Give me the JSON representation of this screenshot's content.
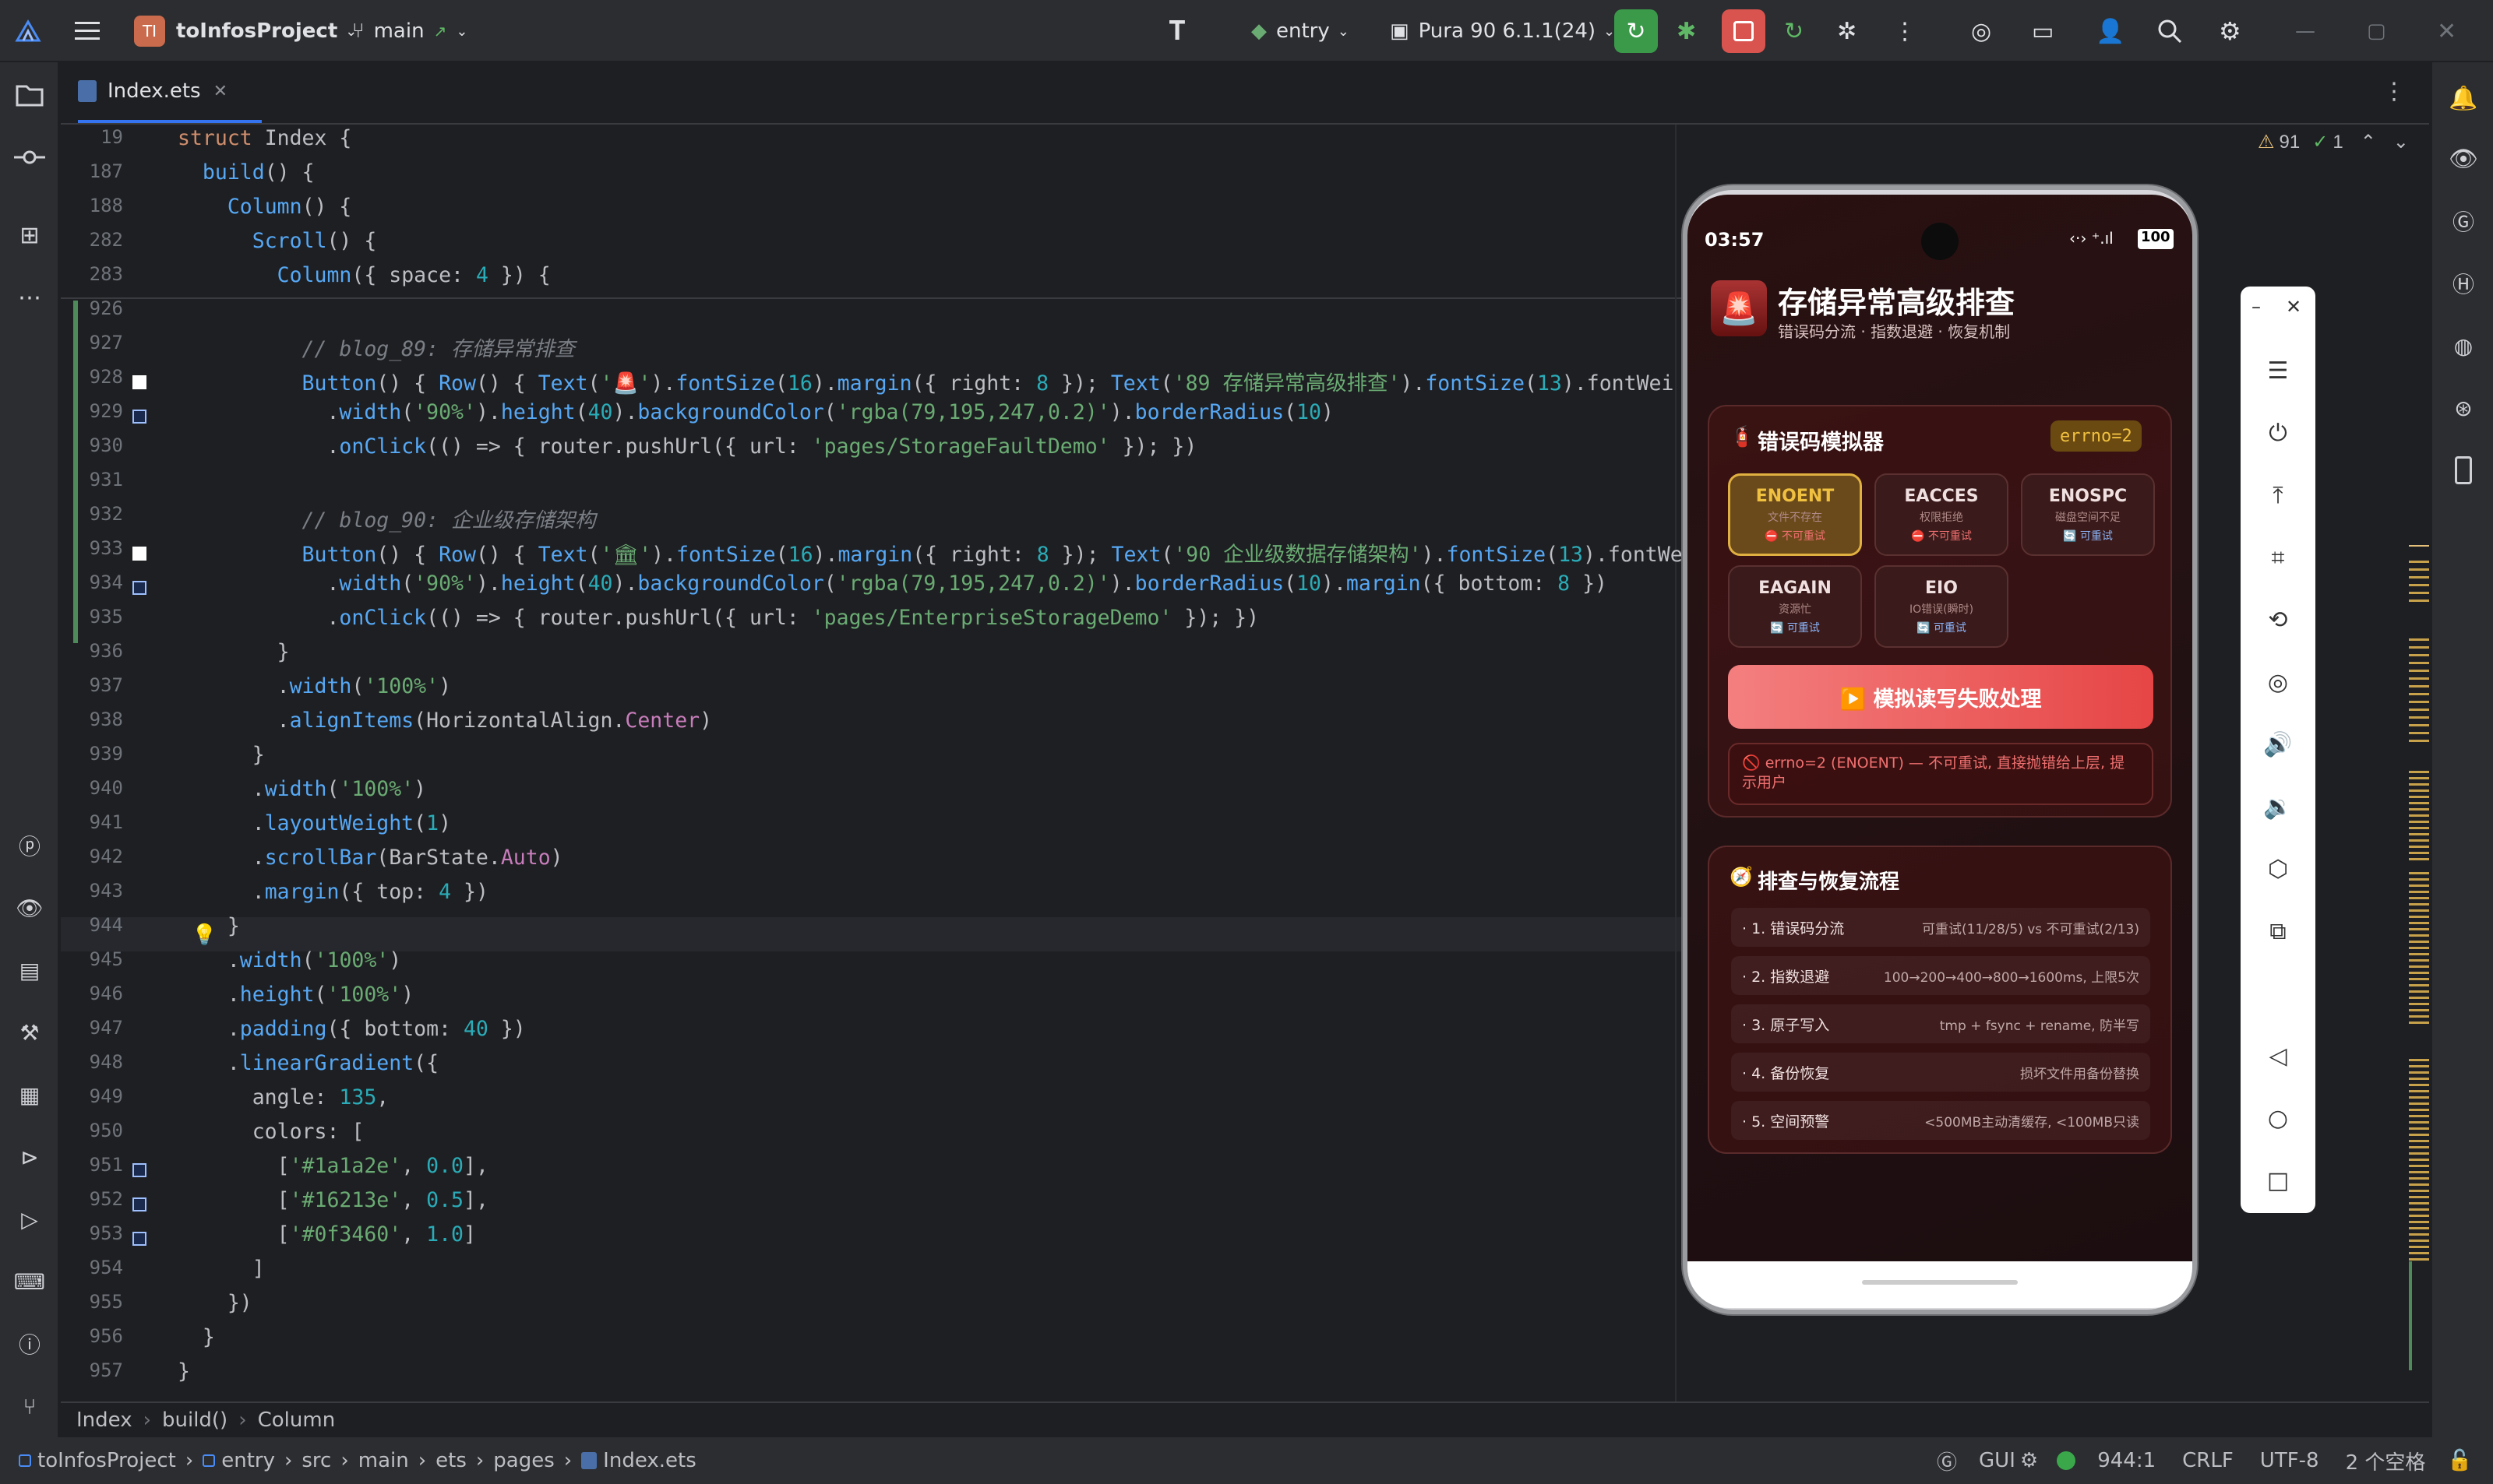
{
  "topbar": {
    "project_badge": "TI",
    "project_name": "toInfosProject",
    "branch": "main",
    "run_config": "entry",
    "device": "Pura 90 6.1.1(24)"
  },
  "tab": {
    "filename": "Index.ets"
  },
  "inspection": {
    "warnings": "91",
    "ok": "1"
  },
  "lines": [
    {
      "num": "19",
      "code": [
        [
          "k",
          "struct "
        ],
        [
          "y",
          "Index {"
        ]
      ]
    },
    {
      "num": "187",
      "code": [
        [
          "y",
          "  "
        ],
        [
          "f",
          "build"
        ],
        [
          "y",
          "() {"
        ]
      ]
    },
    {
      "num": "188",
      "code": [
        [
          "y",
          "    "
        ],
        [
          "f",
          "Column"
        ],
        [
          "y",
          "() {"
        ]
      ]
    },
    {
      "num": "282",
      "code": [
        [
          "y",
          "      "
        ],
        [
          "f",
          "Scroll"
        ],
        [
          "y",
          "() {"
        ]
      ]
    },
    {
      "num": "283",
      "code": [
        [
          "y",
          "        "
        ],
        [
          "f",
          "Column"
        ],
        [
          "y",
          "({ "
        ],
        [
          "y",
          "space"
        ],
        [
          "y",
          ": "
        ],
        [
          "n",
          "4"
        ],
        [
          "y",
          " }) {"
        ]
      ]
    },
    {
      "num": "926",
      "code": []
    },
    {
      "num": "927",
      "code": [
        [
          "y",
          "          "
        ],
        [
          "c",
          "// blog_89: 存储异常排查"
        ]
      ]
    },
    {
      "num": "928",
      "code": [
        [
          "y",
          "          "
        ],
        [
          "f",
          "Button"
        ],
        [
          "y",
          "() { "
        ],
        [
          "f",
          "Row"
        ],
        [
          "y",
          "() { "
        ],
        [
          "f",
          "Text"
        ],
        [
          "y",
          "("
        ],
        [
          "s",
          "'🚨'"
        ],
        [
          "y",
          ")."
        ],
        [
          "f",
          "fontSize"
        ],
        [
          "y",
          "("
        ],
        [
          "n",
          "16"
        ],
        [
          "y",
          ")."
        ],
        [
          "f",
          "margin"
        ],
        [
          "y",
          "({ right: "
        ],
        [
          "n",
          "8"
        ],
        [
          "y",
          " }); "
        ],
        [
          "f",
          "Text"
        ],
        [
          "y",
          "("
        ],
        [
          "s",
          "'89 存储异常高级排查'"
        ],
        [
          "y",
          ")."
        ],
        [
          "f",
          "fontSize"
        ],
        [
          "y",
          "("
        ],
        [
          "n",
          "13"
        ],
        [
          "y",
          ").fontWei"
        ]
      ]
    },
    {
      "num": "929",
      "code": [
        [
          "y",
          "            ."
        ],
        [
          "f",
          "width"
        ],
        [
          "y",
          "("
        ],
        [
          "s",
          "'90%'"
        ],
        [
          "y",
          ")."
        ],
        [
          "f",
          "height"
        ],
        [
          "y",
          "("
        ],
        [
          "n",
          "40"
        ],
        [
          "y",
          ")."
        ],
        [
          "f",
          "backgroundColor"
        ],
        [
          "y",
          "("
        ],
        [
          "s",
          "'rgba(79,195,247,0.2)'"
        ],
        [
          "y",
          ")."
        ],
        [
          "f",
          "borderRadius"
        ],
        [
          "y",
          "("
        ],
        [
          "n",
          "10"
        ],
        [
          "y",
          ")"
        ]
      ]
    },
    {
      "num": "930",
      "code": [
        [
          "y",
          "            ."
        ],
        [
          "f",
          "onClick"
        ],
        [
          "y",
          "(() => { router."
        ],
        [
          "y",
          "pushUrl"
        ],
        [
          "y",
          "({ url: "
        ],
        [
          "s",
          "'pages/StorageFaultDemo'"
        ],
        [
          "y",
          " }); })"
        ]
      ]
    },
    {
      "num": "931",
      "code": []
    },
    {
      "num": "932",
      "code": [
        [
          "y",
          "          "
        ],
        [
          "c",
          "// blog_90: 企业级存储架构"
        ]
      ]
    },
    {
      "num": "933",
      "code": [
        [
          "y",
          "          "
        ],
        [
          "f",
          "Button"
        ],
        [
          "y",
          "() { "
        ],
        [
          "f",
          "Row"
        ],
        [
          "y",
          "() { "
        ],
        [
          "f",
          "Text"
        ],
        [
          "y",
          "("
        ],
        [
          "s",
          "'🏛'"
        ],
        [
          "y",
          ")."
        ],
        [
          "f",
          "fontSize"
        ],
        [
          "y",
          "("
        ],
        [
          "n",
          "16"
        ],
        [
          "y",
          ")."
        ],
        [
          "f",
          "margin"
        ],
        [
          "y",
          "({ right: "
        ],
        [
          "n",
          "8"
        ],
        [
          "y",
          " }); "
        ],
        [
          "f",
          "Text"
        ],
        [
          "y",
          "("
        ],
        [
          "s",
          "'90 企业级数据存储架构'"
        ],
        [
          "y",
          ")."
        ],
        [
          "f",
          "fontSize"
        ],
        [
          "y",
          "("
        ],
        [
          "n",
          "13"
        ],
        [
          "y",
          ").fontWe"
        ]
      ]
    },
    {
      "num": "934",
      "code": [
        [
          "y",
          "            ."
        ],
        [
          "f",
          "width"
        ],
        [
          "y",
          "("
        ],
        [
          "s",
          "'90%'"
        ],
        [
          "y",
          ")."
        ],
        [
          "f",
          "height"
        ],
        [
          "y",
          "("
        ],
        [
          "n",
          "40"
        ],
        [
          "y",
          ")."
        ],
        [
          "f",
          "backgroundColor"
        ],
        [
          "y",
          "("
        ],
        [
          "s",
          "'rgba(79,195,247,0.2)'"
        ],
        [
          "y",
          ")."
        ],
        [
          "f",
          "borderRadius"
        ],
        [
          "y",
          "("
        ],
        [
          "n",
          "10"
        ],
        [
          "y",
          ")."
        ],
        [
          "f",
          "margin"
        ],
        [
          "y",
          "({ bottom: "
        ],
        [
          "n",
          "8"
        ],
        [
          "y",
          " })"
        ]
      ]
    },
    {
      "num": "935",
      "code": [
        [
          "y",
          "            ."
        ],
        [
          "f",
          "onClick"
        ],
        [
          "y",
          "(() => { router."
        ],
        [
          "y",
          "pushUrl"
        ],
        [
          "y",
          "({ url: "
        ],
        [
          "s",
          "'pages/EnterpriseStorageDemo'"
        ],
        [
          "y",
          " }); })"
        ]
      ]
    },
    {
      "num": "936",
      "code": [
        [
          "y",
          "        }"
        ]
      ]
    },
    {
      "num": "937",
      "code": [
        [
          "y",
          "        ."
        ],
        [
          "f",
          "width"
        ],
        [
          "y",
          "("
        ],
        [
          "s",
          "'100%'"
        ],
        [
          "y",
          ")"
        ]
      ]
    },
    {
      "num": "938",
      "code": [
        [
          "y",
          "        ."
        ],
        [
          "f",
          "alignItems"
        ],
        [
          "y",
          "(HorizontalAlign."
        ],
        [
          "p",
          "Center"
        ],
        [
          "y",
          ")"
        ]
      ]
    },
    {
      "num": "939",
      "code": [
        [
          "y",
          "      }"
        ]
      ]
    },
    {
      "num": "940",
      "code": [
        [
          "y",
          "      ."
        ],
        [
          "f",
          "width"
        ],
        [
          "y",
          "("
        ],
        [
          "s",
          "'100%'"
        ],
        [
          "y",
          ")"
        ]
      ]
    },
    {
      "num": "941",
      "code": [
        [
          "y",
          "      ."
        ],
        [
          "f",
          "layoutWeight"
        ],
        [
          "y",
          "("
        ],
        [
          "n",
          "1"
        ],
        [
          "y",
          ")"
        ]
      ]
    },
    {
      "num": "942",
      "code": [
        [
          "y",
          "      ."
        ],
        [
          "f",
          "scrollBar"
        ],
        [
          "y",
          "(BarState."
        ],
        [
          "p",
          "Auto"
        ],
        [
          "y",
          ")"
        ]
      ]
    },
    {
      "num": "943",
      "code": [
        [
          "y",
          "      ."
        ],
        [
          "f",
          "margin"
        ],
        [
          "y",
          "({ top: "
        ],
        [
          "n",
          "4"
        ],
        [
          "y",
          " })"
        ]
      ]
    },
    {
      "num": "944",
      "code": [
        [
          "y",
          "    }"
        ]
      ]
    },
    {
      "num": "945",
      "code": [
        [
          "y",
          "    ."
        ],
        [
          "f",
          "width"
        ],
        [
          "y",
          "("
        ],
        [
          "s",
          "'100%'"
        ],
        [
          "y",
          ")"
        ]
      ]
    },
    {
      "num": "946",
      "code": [
        [
          "y",
          "    ."
        ],
        [
          "f",
          "height"
        ],
        [
          "y",
          "("
        ],
        [
          "s",
          "'100%'"
        ],
        [
          "y",
          ")"
        ]
      ]
    },
    {
      "num": "947",
      "code": [
        [
          "y",
          "    ."
        ],
        [
          "f",
          "padding"
        ],
        [
          "y",
          "({ bottom: "
        ],
        [
          "n",
          "40"
        ],
        [
          "y",
          " })"
        ]
      ]
    },
    {
      "num": "948",
      "code": [
        [
          "y",
          "    ."
        ],
        [
          "f",
          "linearGradient"
        ],
        [
          "y",
          "({"
        ]
      ]
    },
    {
      "num": "949",
      "code": [
        [
          "y",
          "      angle: "
        ],
        [
          "n",
          "135"
        ],
        [
          "y",
          ","
        ]
      ]
    },
    {
      "num": "950",
      "code": [
        [
          "y",
          "      colors: ["
        ]
      ]
    },
    {
      "num": "951",
      "code": [
        [
          "y",
          "        ["
        ],
        [
          "s",
          "'#1a1a2e'"
        ],
        [
          "y",
          ", "
        ],
        [
          "n",
          "0.0"
        ],
        [
          "y",
          "],"
        ]
      ]
    },
    {
      "num": "952",
      "code": [
        [
          "y",
          "        ["
        ],
        [
          "s",
          "'#16213e'"
        ],
        [
          "y",
          ", "
        ],
        [
          "n",
          "0.5"
        ],
        [
          "y",
          "],"
        ]
      ]
    },
    {
      "num": "953",
      "code": [
        [
          "y",
          "        ["
        ],
        [
          "s",
          "'#0f3460'"
        ],
        [
          "y",
          ", "
        ],
        [
          "n",
          "1.0"
        ],
        [
          "y",
          "]"
        ]
      ]
    },
    {
      "num": "954",
      "code": [
        [
          "y",
          "      ]"
        ]
      ]
    },
    {
      "num": "955",
      "code": [
        [
          "y",
          "    })"
        ]
      ]
    },
    {
      "num": "956",
      "code": [
        [
          "y",
          "  }"
        ]
      ]
    },
    {
      "num": "957",
      "code": [
        [
          "y",
          "}"
        ]
      ]
    }
  ],
  "breadcrumb": [
    "Index",
    "build()",
    "Column"
  ],
  "status": {
    "path": [
      "toInfosProject",
      "entry",
      "src",
      "main",
      "ets",
      "pages",
      "Index.ets"
    ],
    "gui": "GUI",
    "position": "944:1",
    "line_sep": "CRLF",
    "encoding": "UTF-8",
    "indent": "2 个空格"
  },
  "phone": {
    "time": "03:57",
    "battery": "100",
    "title": "存储异常高级排查",
    "subtitle": "错误码分流 · 指数退避 · 恢复机制",
    "sim_title": "错误码模拟器",
    "errno_badge": "errno=2",
    "errors": [
      {
        "code": "ENOENT",
        "desc": "文件不存在",
        "retry": "⛔ 不可重试"
      },
      {
        "code": "EACCES",
        "desc": "权限拒绝",
        "retry": "⛔ 不可重试"
      },
      {
        "code": "ENOSPC",
        "desc": "磁盘空间不足",
        "retry": "🔄 可重试"
      },
      {
        "code": "EAGAIN",
        "desc": "资源忙",
        "retry": "🔄 可重试"
      },
      {
        "code": "EIO",
        "desc": "IO错误(瞬时)",
        "retry": "🔄 可重试"
      }
    ],
    "simulate_button": "▶️ 模拟读写失败处理",
    "result": "🚫 errno=2 (ENOENT) — 不可重试, 直接抛错给上层, 提示用户",
    "flow_title": "排查与恢复流程",
    "flow": [
      {
        "step": "· 1. 错误码分流",
        "detail": "可重试(11/28/5) vs 不可重试(2/13)"
      },
      {
        "step": "· 2. 指数退避",
        "detail": "100→200→400→800→1600ms, 上限5次"
      },
      {
        "step": "· 3. 原子写入",
        "detail": "tmp + fsync + rename, 防半写"
      },
      {
        "step": "· 4. 备份恢复",
        "detail": "损坏文件用备份替换"
      },
      {
        "step": "· 5. 空间预警",
        "detail": "<500MB主动清缓存, <100MB只读"
      }
    ]
  },
  "colors": {
    "accent": "#3574f0",
    "run_green": "#3a9a4a",
    "stop_red": "#d9534f",
    "phone_btn": "#f06060"
  }
}
